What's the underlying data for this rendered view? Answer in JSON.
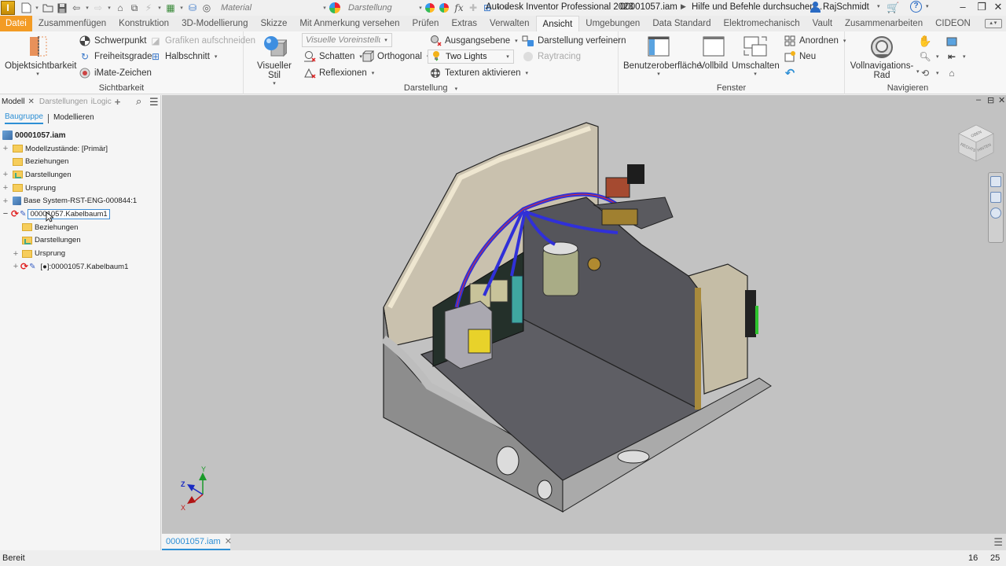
{
  "titlebar": {
    "app_name": "Autodesk Inventor Professional 2023",
    "file_name": "00001057.iam",
    "help_search": "Hilfe und Befehle durchsuchen...",
    "username": "RajSchmidt",
    "material_combo": "Material",
    "appearance_combo": "Darstellung",
    "logo_letter": "I",
    "fx_label": "fx"
  },
  "ribbon_tabs": [
    {
      "label": "Datei"
    },
    {
      "label": "Zusammenfügen"
    },
    {
      "label": "Konstruktion"
    },
    {
      "label": "3D-Modellierung"
    },
    {
      "label": "Skizze"
    },
    {
      "label": "Mit Anmerkung versehen"
    },
    {
      "label": "Prüfen"
    },
    {
      "label": "Extras"
    },
    {
      "label": "Verwalten"
    },
    {
      "label": "Ansicht",
      "active": true
    },
    {
      "label": "Umgebungen"
    },
    {
      "label": "Data Standard"
    },
    {
      "label": "Elektromechanisch"
    },
    {
      "label": "Vault"
    },
    {
      "label": "Zusammenarbeiten"
    },
    {
      "label": "CIDEON"
    }
  ],
  "ribbon": {
    "sichtbarkeit": {
      "title": "Sichtbarkeit",
      "objektsichtbarkeit": "Objektsichtbarkeit",
      "schwerpunkt": "Schwerpunkt",
      "freiheitsgrade": "Freiheitsgrade",
      "imate": "iMate-Zeichen",
      "grafiken_aufschneiden": "Grafiken aufschneiden",
      "halbschnitt": "Halbschnitt"
    },
    "darstellung": {
      "title": "Darstellung",
      "visueller_stil": "Visueller Stil",
      "visuelle_voreinstellung": "Visuelle Voreinstellung",
      "schatten": "Schatten",
      "orthogonal": "Orthogonal",
      "reflexionen": "Reflexionen",
      "ausgangsebene": "Ausgangsebene",
      "lighting": "Two Lights",
      "texturen": "Texturen aktivieren",
      "darstellung_verfeinern": "Darstellung verfeinern",
      "raytracing": "Raytracing"
    },
    "fenster": {
      "title": "Fenster",
      "benutzeroberflaeche": "Benutzeroberfläche",
      "vollbild": "Vollbild",
      "umschalten": "Umschalten",
      "anordnen": "Anordnen",
      "neu": "Neu"
    },
    "navigieren": {
      "title": "Navigieren",
      "vollnavigations": "Vollnavigations-",
      "rad": "Rad"
    }
  },
  "browser": {
    "tabs": [
      {
        "label": "Modell",
        "active": true
      },
      {
        "label": "Darstellungen"
      },
      {
        "label": "iLogic"
      }
    ],
    "subtabs": [
      {
        "label": "Baugruppe",
        "active": true
      },
      {
        "label": "Modellieren"
      }
    ],
    "tree": [
      {
        "label": "00001057.iam",
        "level": 0,
        "icon": "assembly-icon"
      },
      {
        "label": "Modellzustände: [Primär]",
        "level": 1,
        "icon": "folder-icon",
        "expand": "+"
      },
      {
        "label": "Beziehungen",
        "level": 1,
        "icon": "folder-icon"
      },
      {
        "label": "Darstellungen",
        "level": 1,
        "icon": "representations-icon",
        "expand": "+"
      },
      {
        "label": "Ursprung",
        "level": 1,
        "icon": "folder-icon",
        "expand": "+"
      },
      {
        "label": "Base System-RST-ENG-000844:1",
        "level": 1,
        "icon": "subassembly-icon",
        "expand": "+"
      },
      {
        "label": "00001057.Kabelbaum1",
        "level": 1,
        "icon": "harness-icon",
        "expand": "−",
        "selected": true
      },
      {
        "label": "Beziehungen",
        "level": 2,
        "icon": "folder-icon"
      },
      {
        "label": "Darstellungen",
        "level": 2,
        "icon": "representations-icon"
      },
      {
        "label": "Ursprung",
        "level": 2,
        "icon": "folder-icon",
        "expand": "+"
      },
      {
        "label": "[●]:00001057.Kabelbaum1",
        "level": 2,
        "icon": "harness-icon",
        "expand": "+"
      }
    ]
  },
  "viewport": {
    "viewcube_faces": [
      "OBEN",
      "RECHTS",
      "HINTEN"
    ],
    "triad_axes": [
      "X",
      "Y",
      "Z"
    ],
    "colors": {
      "x": "#c21a1a",
      "y": "#1a9a2a",
      "z": "#1a2ac2"
    }
  },
  "document_tabs": [
    {
      "label": "00001057.iam",
      "active": true
    }
  ],
  "statusbar": {
    "status": "Bereit",
    "num1": "16",
    "num2": "25"
  },
  "colors": {
    "file_tab": "#f39b24",
    "accent": "#2d8fd5",
    "viewport_bg": "#c2c2c2"
  }
}
